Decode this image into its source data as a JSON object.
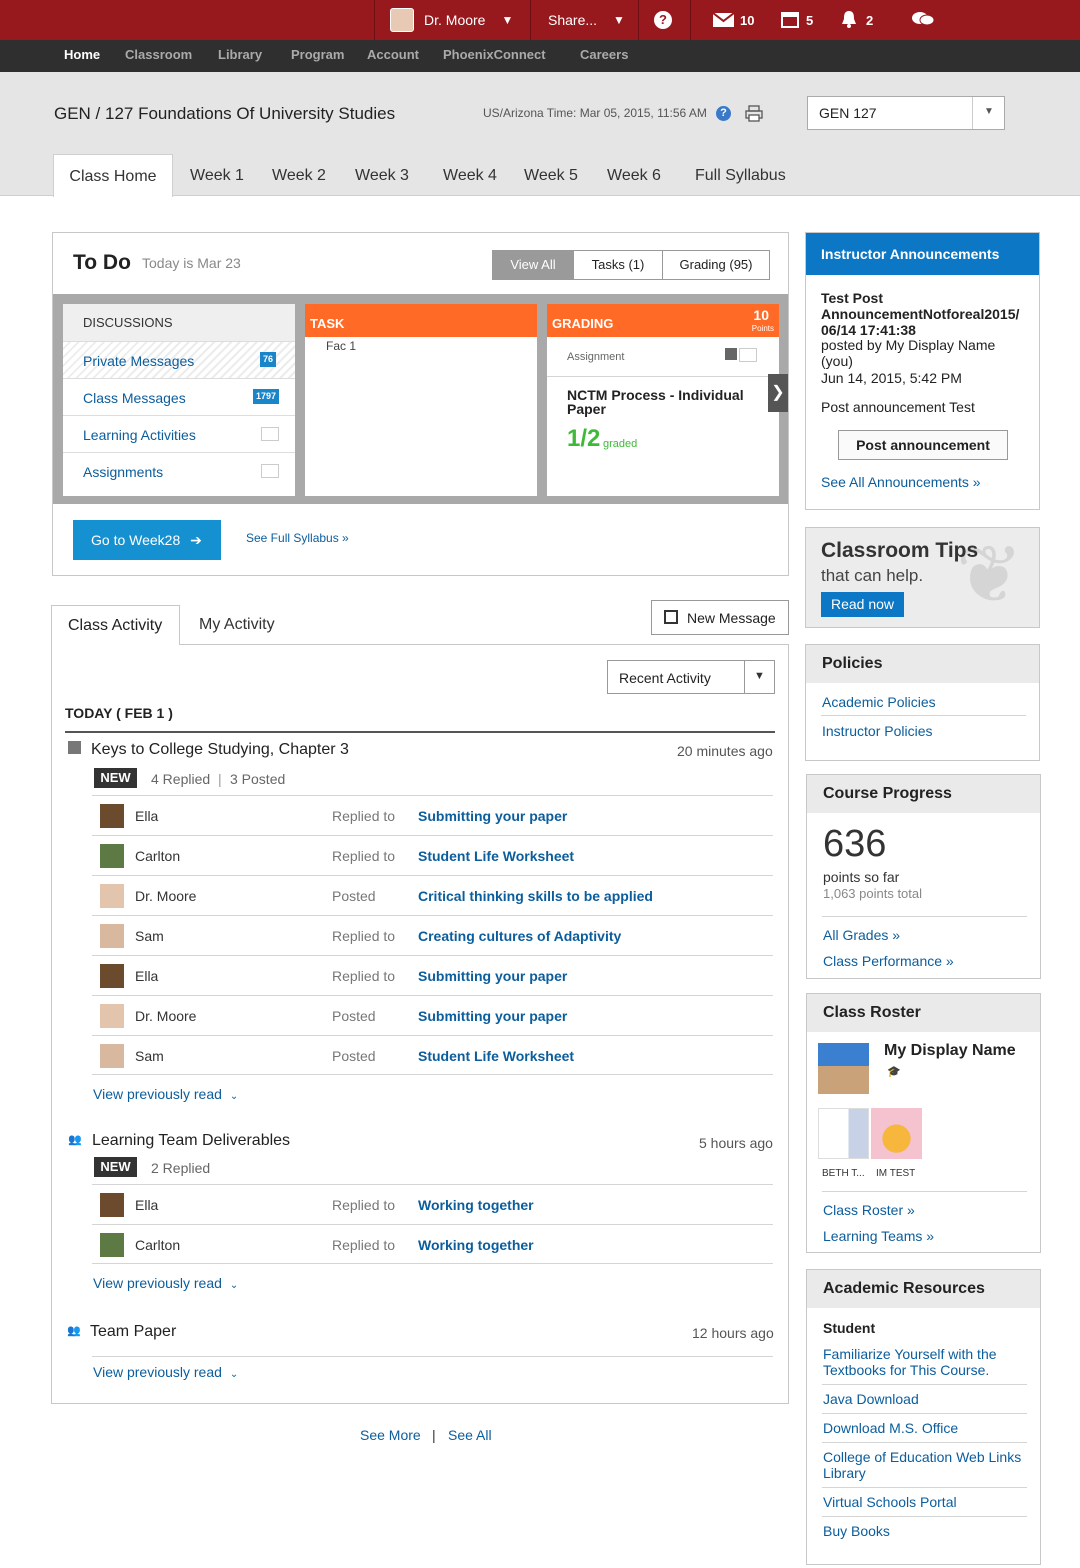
{
  "topbar": {
    "user": "Dr. Moore",
    "share": "Share...",
    "mail_count": "10",
    "calendar_count": "5",
    "alerts_count": "2"
  },
  "nav": {
    "items": [
      "Home",
      "Classroom",
      "Library",
      "Program",
      "Account",
      "PhoenixConnect",
      "Careers"
    ]
  },
  "header": {
    "course_title": "GEN / 127 Foundations Of University Studies",
    "time": "US/Arizona Time: Mar 05, 2015, 11:56 AM",
    "course_select": "GEN 127"
  },
  "week_tabs": [
    "Class Home",
    "Week 1",
    "Week 2",
    "Week 3",
    "Week 4",
    "Week 5",
    "Week 6",
    "Full Syllabus"
  ],
  "todo": {
    "title": "To Do",
    "date": "Today is Mar 23",
    "view_all": "View All",
    "tasks": "Tasks (1)",
    "grading": "Grading (95)",
    "discussions_header": "DISCUSSIONS",
    "discussions": [
      {
        "label": "Private Messages",
        "count": "76"
      },
      {
        "label": "Class Messages",
        "count": "1797"
      },
      {
        "label": "Learning Activities",
        "count": ""
      },
      {
        "label": "Assignments",
        "count": ""
      }
    ],
    "task_header": "TASK",
    "task_item": "Fac 1",
    "grading_header": "GRADING",
    "grading_points": "10",
    "grading_points_label": "Points",
    "grading_type": "Assignment",
    "grading_title": "NCTM Process - Individual Paper",
    "grading_score": "1/2",
    "grading_status": "graded",
    "go_button": "Go to Week28",
    "full_syllabus": "See Full Syllabus »"
  },
  "activity": {
    "tab_class": "Class Activity",
    "tab_my": "My Activity",
    "new_message": "New Message",
    "filter": "Recent Activity",
    "today": "TODAY ( FEB 1 )",
    "groups": [
      {
        "title": "Keys to College Studying, Chapter 3",
        "time": "20 minutes ago",
        "badge": "NEW",
        "meta1": "4 Replied",
        "meta2": "3 Posted",
        "rows": [
          {
            "name": "Ella",
            "action": "Replied to",
            "link": "Submitting your paper"
          },
          {
            "name": "Carlton",
            "action": "Replied to",
            "link": "Student Life Worksheet"
          },
          {
            "name": "Dr. Moore",
            "action": "Posted",
            "link": "Critical thinking skills to be applied"
          },
          {
            "name": "Sam",
            "action": "Replied to",
            "link": "Creating cultures of Adaptivity"
          },
          {
            "name": "Ella",
            "action": "Replied to",
            "link": "Submitting your paper"
          },
          {
            "name": "Dr. Moore",
            "action": "Posted",
            "link": "Submitting your paper"
          },
          {
            "name": "Sam",
            "action": "Posted",
            "link": "Student Life Worksheet"
          }
        ],
        "view_prev": "View previously read"
      },
      {
        "title": "Learning Team Deliverables",
        "time": "5 hours ago",
        "badge": "NEW",
        "meta1": "2 Replied",
        "rows": [
          {
            "name": "Ella",
            "action": "Replied to",
            "link": "Working together"
          },
          {
            "name": "Carlton",
            "action": "Replied to",
            "link": "Working together"
          }
        ],
        "view_prev": "View previously read"
      },
      {
        "title": "Team Paper",
        "time": "12 hours ago",
        "view_prev": "View previously read"
      }
    ],
    "see_more": "See More",
    "see_all": "See All"
  },
  "announcements": {
    "title": "Instructor Announcements",
    "post_title": "Test Post AnnouncementNotforeal2015/ 06/14 17:41:38",
    "posted_by": "posted by My Display Name (you)",
    "date": "Jun 14, 2015, 5:42 PM",
    "body": "Post announcement Test",
    "button": "Post announcement",
    "see_all": "See All Announcements »"
  },
  "tips": {
    "title": "Classroom Tips",
    "subtitle": "that can help.",
    "button": "Read now"
  },
  "policies": {
    "title": "Policies",
    "links": [
      "Academic Policies",
      "Instructor Policies"
    ]
  },
  "progress": {
    "title": "Course Progress",
    "points": "636",
    "points_label": "points so far",
    "total": "1,063 points total",
    "links": [
      "All Grades »",
      "Class Performance »"
    ]
  },
  "roster": {
    "title": "Class Roster",
    "display_name": "My Display Name",
    "members": [
      "BETH T...",
      "IM TEST"
    ],
    "links": [
      "Class Roster »",
      "Learning Teams »"
    ]
  },
  "resources": {
    "title": "Academic Resources",
    "subhead": "Student",
    "links": [
      "Familiarize Yourself with the Textbooks for This Course.",
      "Java Download",
      "Download M.S. Office",
      "College of Education Web Links Library",
      "Virtual Schools Portal",
      "Buy Books"
    ]
  },
  "colors": {
    "topbar": "#97181d",
    "nav": "#2f2f2f",
    "task_orange": "#ff6a26",
    "announce_blue": "#0b77c5",
    "link": "#0b5d9c",
    "go_button": "#1590d0",
    "score_green": "#3fb93a"
  }
}
